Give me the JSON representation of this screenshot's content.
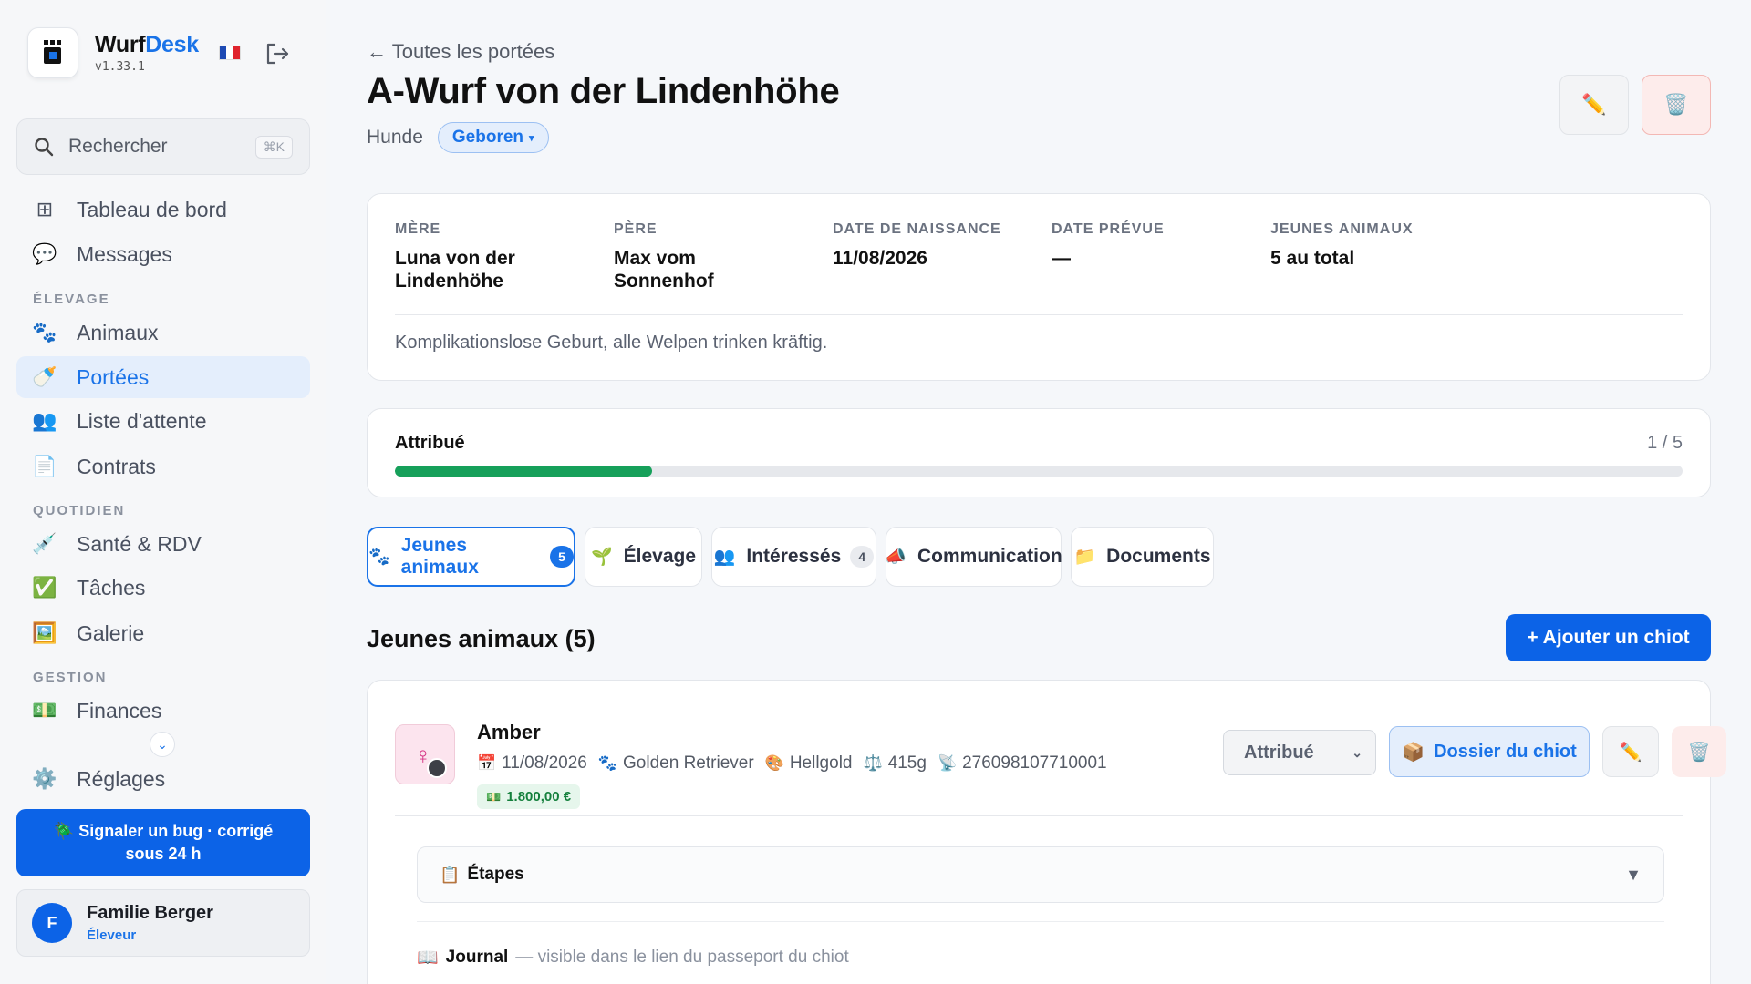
{
  "app": {
    "name_part1": "Wurf",
    "name_part2": "Desk",
    "version": "v1.33.1"
  },
  "search": {
    "placeholder": "Rechercher",
    "shortcut": "⌘K"
  },
  "sidebar": {
    "items": [
      {
        "label": "Tableau de bord",
        "icon": "grid-icon"
      },
      {
        "label": "Messages",
        "icon": "speech-bubble-icon"
      },
      {
        "label": "Animaux",
        "icon": "paw-icon"
      },
      {
        "label": "Portées",
        "icon": "baby-bottle-icon",
        "active": true
      },
      {
        "label": "Liste d'attente",
        "icon": "people-icon"
      },
      {
        "label": "Contrats",
        "icon": "document-icon"
      },
      {
        "label": "Santé & RDV",
        "icon": "syringe-icon"
      },
      {
        "label": "Tâches",
        "icon": "check-box-icon"
      },
      {
        "label": "Galerie",
        "icon": "picture-icon"
      },
      {
        "label": "Finances",
        "icon": "banknote-icon"
      },
      {
        "label": "Réglages",
        "icon": "gear-icon"
      }
    ],
    "sections": {
      "elevage": "ÉLEVAGE",
      "quotidien": "QUOTIDIEN",
      "gestion": "GESTION"
    },
    "bug_button": "🪲 Signaler un bug · corrigé sous 24 h",
    "user": {
      "initial": "F",
      "name": "Familie Berger",
      "role": "Éleveur"
    }
  },
  "header": {
    "back_link": "← Toutes les portées",
    "title": "A-Wurf von der Lindenhöhe",
    "species": "Hunde",
    "status": "Geboren"
  },
  "info": {
    "mother_label": "MÈRE",
    "mother": "Luna von der Lindenhöhe",
    "father_label": "PÈRE",
    "father": "Max vom Sonnenhof",
    "birth_label": "DATE DE NAISSANCE",
    "birth": "11/08/2026",
    "expected_label": "DATE PRÉVUE",
    "expected": "—",
    "young_label": "JEUNES ANIMAUX",
    "young": "5 au total",
    "note": "Komplikationslose Geburt, alle Welpen trinken kräftig."
  },
  "progress": {
    "label": "Attribué",
    "count_text": "1 / 5",
    "fraction": 0.2,
    "color": "#16a05a"
  },
  "tabs": [
    {
      "label": "Jeunes animaux",
      "count": "5",
      "active": true
    },
    {
      "label": "Élevage"
    },
    {
      "label": "Intéressés",
      "count": "4"
    },
    {
      "label": "Communication"
    },
    {
      "label": "Documents"
    }
  ],
  "puppies_section": {
    "title": "Jeunes animaux (5)",
    "add_button": "+ Ajouter un chiot"
  },
  "puppy": {
    "name": "Amber",
    "birth": "11/08/2026",
    "breed": "Golden Retriever",
    "color": "Hellgold",
    "weight": "415g",
    "chip": "276098107710001",
    "price": "1.800,00 €",
    "status": "Attribué",
    "dossier_button": "Dossier du chiot",
    "steps_label": "Étapes",
    "journal_label": "Journal",
    "journal_hint": "— visible dans le lien du passeport du chiot"
  },
  "colors": {
    "accent": "#1a73e8",
    "primary_button": "#0c63e7",
    "success": "#16a05a"
  }
}
